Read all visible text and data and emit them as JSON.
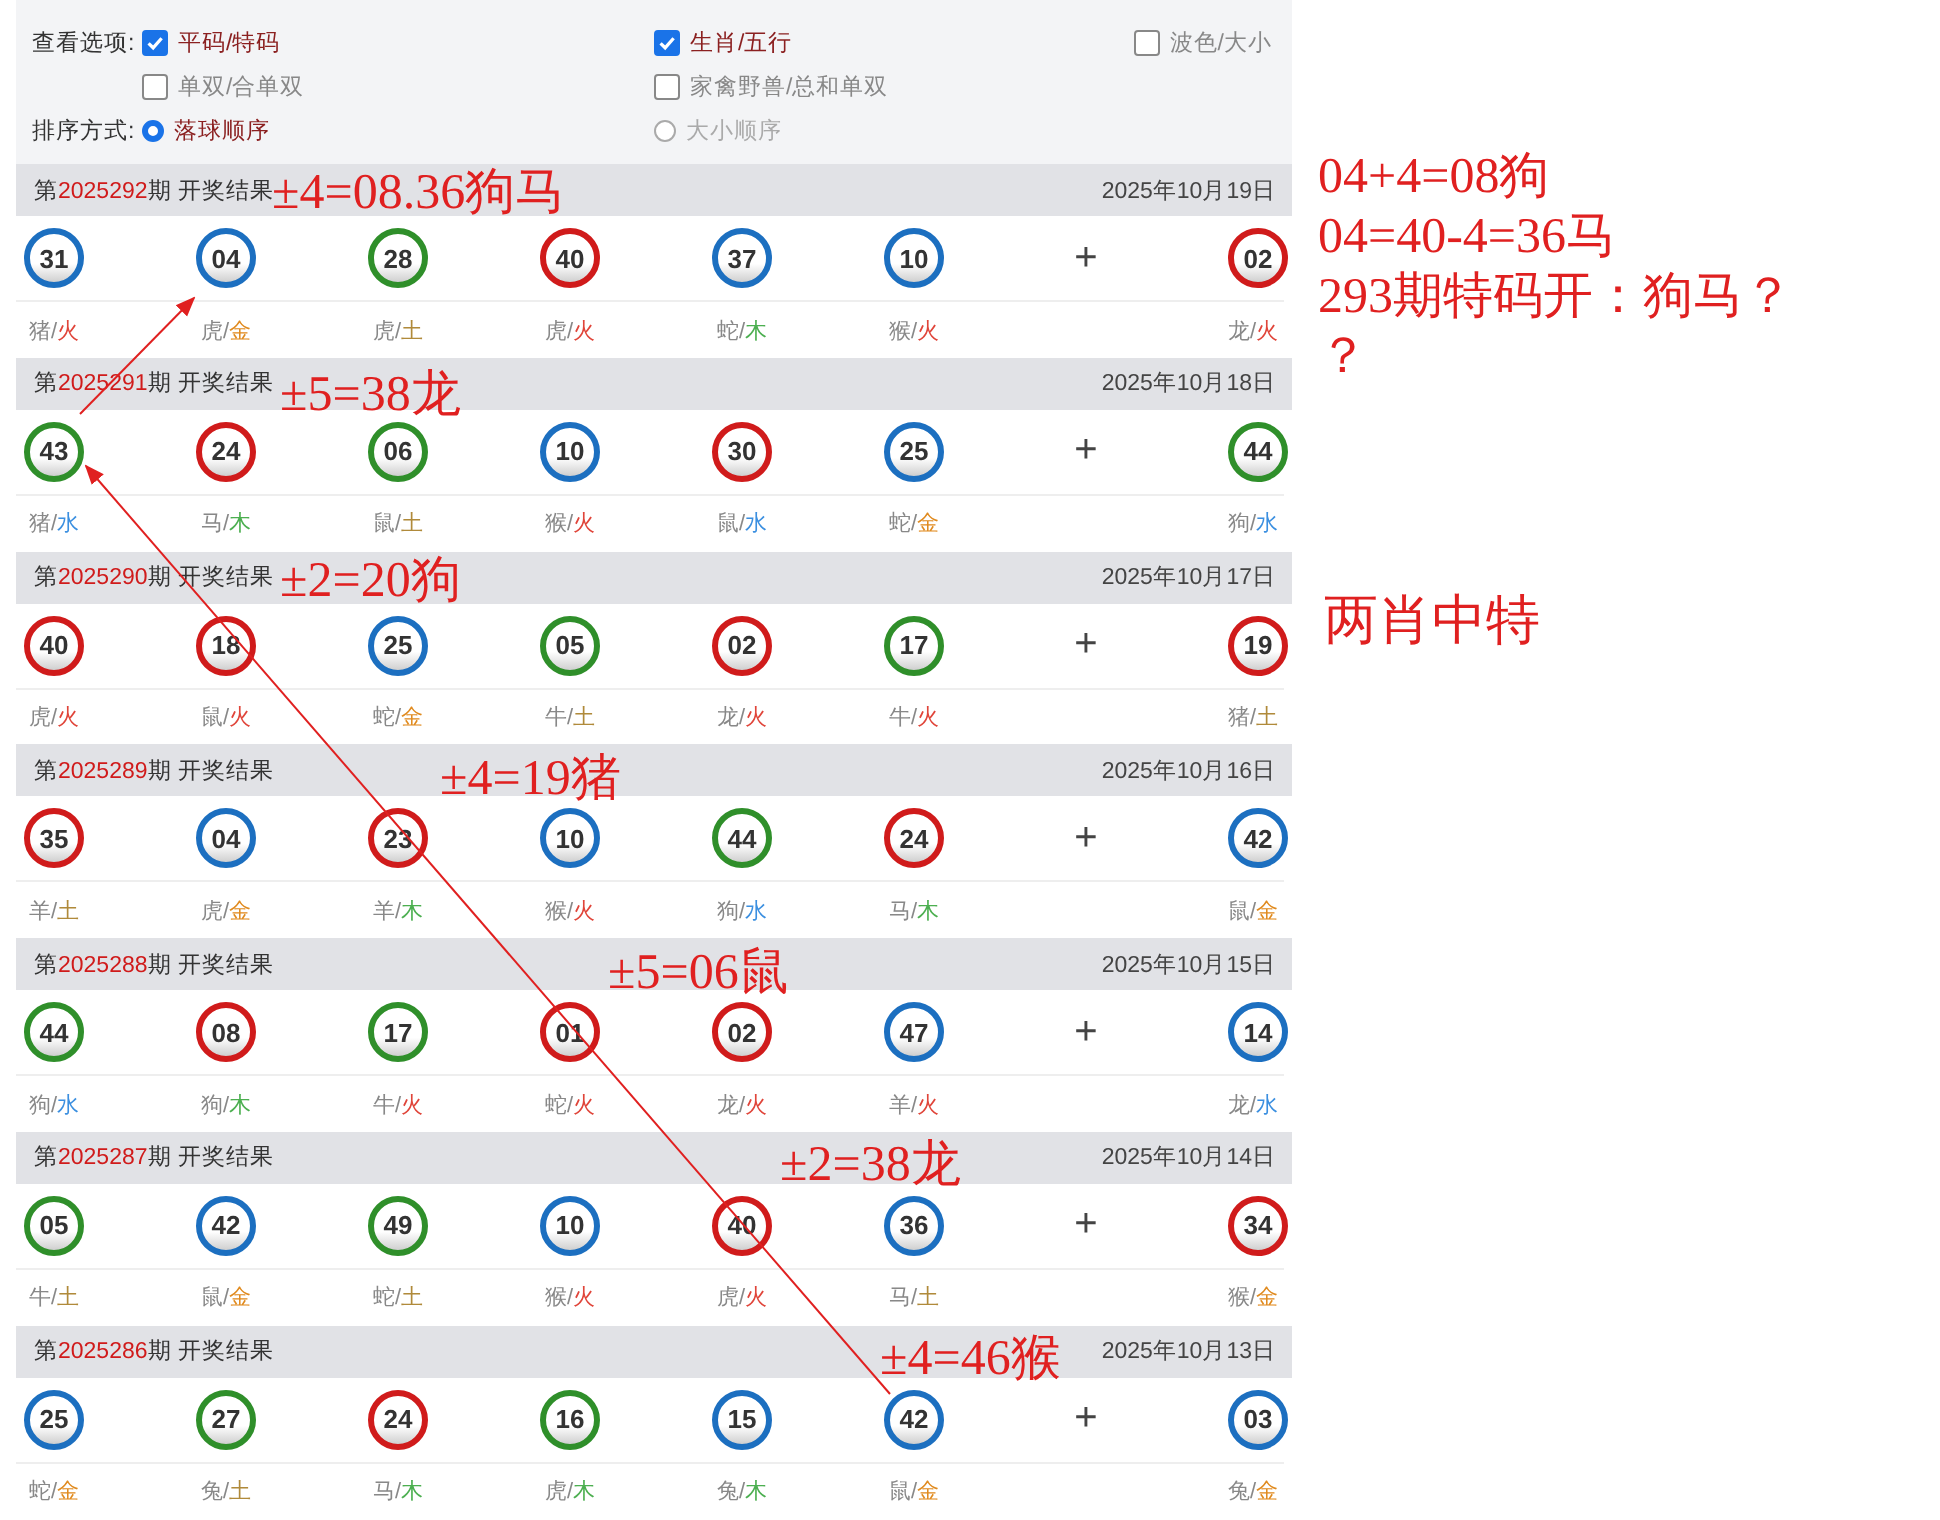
{
  "options": {
    "view_label": "查看选项:",
    "sort_label": "排序方式:",
    "checkboxes": [
      {
        "label": "平码/特码",
        "checked": true
      },
      {
        "label": "生肖/五行",
        "checked": true
      },
      {
        "label": "波色/大小",
        "checked": false
      },
      {
        "label": "单双/合单双",
        "checked": false
      },
      {
        "label": "家禽野兽/总和单双",
        "checked": false
      }
    ],
    "sort_options": [
      {
        "label": "落球顺序",
        "selected": true
      },
      {
        "label": "大小顺序",
        "selected": false
      }
    ]
  },
  "draws": [
    {
      "prefix": "第",
      "issue": "2025292",
      "suffix": "期 开奖结果",
      "date": "2025年10月19日",
      "separator": "+",
      "balls": [
        {
          "number": "31",
          "color": "#1c6fc0",
          "zodiac": "猪/",
          "element": {
            "name": "火",
            "color": "#e0453a"
          }
        },
        {
          "number": "04",
          "color": "#1c6fc0",
          "zodiac": "虎/",
          "element": {
            "name": "金",
            "color": "#e08a1e"
          }
        },
        {
          "number": "28",
          "color": "#2f8f2a",
          "zodiac": "虎/",
          "element": {
            "name": "土",
            "color": "#b08a3a"
          }
        },
        {
          "number": "40",
          "color": "#d01b1b",
          "zodiac": "虎/",
          "element": {
            "name": "火",
            "color": "#e0453a"
          }
        },
        {
          "number": "37",
          "color": "#1c6fc0",
          "zodiac": "蛇/",
          "element": {
            "name": "木",
            "color": "#4caf50"
          }
        },
        {
          "number": "10",
          "color": "#1c6fc0",
          "zodiac": "猴/",
          "element": {
            "name": "火",
            "color": "#e0453a"
          }
        },
        {
          "number": "02",
          "color": "#d01b1b",
          "zodiac": "龙/",
          "element": {
            "name": "火",
            "color": "#e0453a"
          }
        }
      ]
    },
    {
      "prefix": "第",
      "issue": "2025291",
      "suffix": "期 开奖结果",
      "date": "2025年10月18日",
      "separator": "+",
      "balls": [
        {
          "number": "43",
          "color": "#2f8f2a",
          "zodiac": "猪/",
          "element": {
            "name": "水",
            "color": "#3b8fe0"
          }
        },
        {
          "number": "24",
          "color": "#d01b1b",
          "zodiac": "马/",
          "element": {
            "name": "木",
            "color": "#4caf50"
          }
        },
        {
          "number": "06",
          "color": "#2f8f2a",
          "zodiac": "鼠/",
          "element": {
            "name": "土",
            "color": "#b08a3a"
          }
        },
        {
          "number": "10",
          "color": "#1c6fc0",
          "zodiac": "猴/",
          "element": {
            "name": "火",
            "color": "#e0453a"
          }
        },
        {
          "number": "30",
          "color": "#d01b1b",
          "zodiac": "鼠/",
          "element": {
            "name": "水",
            "color": "#3b8fe0"
          }
        },
        {
          "number": "25",
          "color": "#1c6fc0",
          "zodiac": "蛇/",
          "element": {
            "name": "金",
            "color": "#e08a1e"
          }
        },
        {
          "number": "44",
          "color": "#2f8f2a",
          "zodiac": "狗/",
          "element": {
            "name": "水",
            "color": "#3b8fe0"
          }
        }
      ]
    },
    {
      "prefix": "第",
      "issue": "2025290",
      "suffix": "期 开奖结果",
      "date": "2025年10月17日",
      "separator": "+",
      "balls": [
        {
          "number": "40",
          "color": "#d01b1b",
          "zodiac": "虎/",
          "element": {
            "name": "火",
            "color": "#e0453a"
          }
        },
        {
          "number": "18",
          "color": "#d01b1b",
          "zodiac": "鼠/",
          "element": {
            "name": "火",
            "color": "#e0453a"
          }
        },
        {
          "number": "25",
          "color": "#1c6fc0",
          "zodiac": "蛇/",
          "element": {
            "name": "金",
            "color": "#e08a1e"
          }
        },
        {
          "number": "05",
          "color": "#2f8f2a",
          "zodiac": "牛/",
          "element": {
            "name": "土",
            "color": "#b08a3a"
          }
        },
        {
          "number": "02",
          "color": "#d01b1b",
          "zodiac": "龙/",
          "element": {
            "name": "火",
            "color": "#e0453a"
          }
        },
        {
          "number": "17",
          "color": "#2f8f2a",
          "zodiac": "牛/",
          "element": {
            "name": "火",
            "color": "#e0453a"
          }
        },
        {
          "number": "19",
          "color": "#d01b1b",
          "zodiac": "猪/",
          "element": {
            "name": "土",
            "color": "#b08a3a"
          }
        }
      ]
    },
    {
      "prefix": "第",
      "issue": "2025289",
      "suffix": "期 开奖结果",
      "date": "2025年10月16日",
      "separator": "+",
      "balls": [
        {
          "number": "35",
          "color": "#d01b1b",
          "zodiac": "羊/",
          "element": {
            "name": "土",
            "color": "#b08a3a"
          }
        },
        {
          "number": "04",
          "color": "#1c6fc0",
          "zodiac": "虎/",
          "element": {
            "name": "金",
            "color": "#e08a1e"
          }
        },
        {
          "number": "23",
          "color": "#d01b1b",
          "zodiac": "羊/",
          "element": {
            "name": "木",
            "color": "#4caf50"
          }
        },
        {
          "number": "10",
          "color": "#1c6fc0",
          "zodiac": "猴/",
          "element": {
            "name": "火",
            "color": "#e0453a"
          }
        },
        {
          "number": "44",
          "color": "#2f8f2a",
          "zodiac": "狗/",
          "element": {
            "name": "水",
            "color": "#3b8fe0"
          }
        },
        {
          "number": "24",
          "color": "#d01b1b",
          "zodiac": "马/",
          "element": {
            "name": "木",
            "color": "#4caf50"
          }
        },
        {
          "number": "42",
          "color": "#1c6fc0",
          "zodiac": "鼠/",
          "element": {
            "name": "金",
            "color": "#e08a1e"
          }
        }
      ]
    },
    {
      "prefix": "第",
      "issue": "2025288",
      "suffix": "期 开奖结果",
      "date": "2025年10月15日",
      "separator": "+",
      "balls": [
        {
          "number": "44",
          "color": "#2f8f2a",
          "zodiac": "狗/",
          "element": {
            "name": "水",
            "color": "#3b8fe0"
          }
        },
        {
          "number": "08",
          "color": "#d01b1b",
          "zodiac": "狗/",
          "element": {
            "name": "木",
            "color": "#4caf50"
          }
        },
        {
          "number": "17",
          "color": "#2f8f2a",
          "zodiac": "牛/",
          "element": {
            "name": "火",
            "color": "#e0453a"
          }
        },
        {
          "number": "01",
          "color": "#d01b1b",
          "zodiac": "蛇/",
          "element": {
            "name": "火",
            "color": "#e0453a"
          }
        },
        {
          "number": "02",
          "color": "#d01b1b",
          "zodiac": "龙/",
          "element": {
            "name": "火",
            "color": "#e0453a"
          }
        },
        {
          "number": "47",
          "color": "#1c6fc0",
          "zodiac": "羊/",
          "element": {
            "name": "火",
            "color": "#e0453a"
          }
        },
        {
          "number": "14",
          "color": "#1c6fc0",
          "zodiac": "龙/",
          "element": {
            "name": "水",
            "color": "#3b8fe0"
          }
        }
      ]
    },
    {
      "prefix": "第",
      "issue": "2025287",
      "suffix": "期 开奖结果",
      "date": "2025年10月14日",
      "separator": "+",
      "balls": [
        {
          "number": "05",
          "color": "#2f8f2a",
          "zodiac": "牛/",
          "element": {
            "name": "土",
            "color": "#b08a3a"
          }
        },
        {
          "number": "42",
          "color": "#1c6fc0",
          "zodiac": "鼠/",
          "element": {
            "name": "金",
            "color": "#e08a1e"
          }
        },
        {
          "number": "49",
          "color": "#2f8f2a",
          "zodiac": "蛇/",
          "element": {
            "name": "土",
            "color": "#b08a3a"
          }
        },
        {
          "number": "10",
          "color": "#1c6fc0",
          "zodiac": "猴/",
          "element": {
            "name": "火",
            "color": "#e0453a"
          }
        },
        {
          "number": "40",
          "color": "#d01b1b",
          "zodiac": "虎/",
          "element": {
            "name": "火",
            "color": "#e0453a"
          }
        },
        {
          "number": "36",
          "color": "#1c6fc0",
          "zodiac": "马/",
          "element": {
            "name": "土",
            "color": "#b08a3a"
          }
        },
        {
          "number": "34",
          "color": "#d01b1b",
          "zodiac": "猴/",
          "element": {
            "name": "金",
            "color": "#e08a1e"
          }
        }
      ]
    },
    {
      "prefix": "第",
      "issue": "2025286",
      "suffix": "期 开奖结果",
      "date": "2025年10月13日",
      "separator": "+",
      "balls": [
        {
          "number": "25",
          "color": "#1c6fc0",
          "zodiac": "蛇/",
          "element": {
            "name": "金",
            "color": "#e08a1e"
          }
        },
        {
          "number": "27",
          "color": "#2f8f2a",
          "zodiac": "兔/",
          "element": {
            "name": "土",
            "color": "#b08a3a"
          }
        },
        {
          "number": "24",
          "color": "#d01b1b",
          "zodiac": "马/",
          "element": {
            "name": "木",
            "color": "#4caf50"
          }
        },
        {
          "number": "16",
          "color": "#2f8f2a",
          "zodiac": "虎/",
          "element": {
            "name": "木",
            "color": "#4caf50"
          }
        },
        {
          "number": "15",
          "color": "#1c6fc0",
          "zodiac": "兔/",
          "element": {
            "name": "木",
            "color": "#4caf50"
          }
        },
        {
          "number": "42",
          "color": "#1c6fc0",
          "zodiac": "鼠/",
          "element": {
            "name": "金",
            "color": "#e08a1e"
          }
        },
        {
          "number": "03",
          "color": "#1c6fc0",
          "zodiac": "兔/",
          "element": {
            "name": "金",
            "color": "#e08a1e"
          }
        }
      ]
    }
  ],
  "annotations": [
    "±4=08.36狗马",
    "±5=38龙",
    "±2=20狗",
    "±4=19猪",
    "±5=06鼠",
    "±2=38龙",
    "±4=46猴"
  ],
  "notes": [
    "04+4=08狗",
    "04=40-4=36马",
    "293期特码开：狗马？",
    "？"
  ],
  "conclusion": "两肖中特"
}
